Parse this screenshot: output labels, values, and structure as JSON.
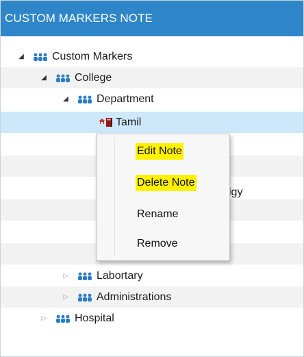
{
  "header": {
    "title": "CUSTOM MARKERS NOTE"
  },
  "tree": {
    "root": {
      "label": "Custom Markers"
    },
    "college": {
      "label": "College"
    },
    "department": {
      "label": "Department"
    },
    "tamil": {
      "label": "Tamil"
    },
    "hidden_item_suffix": "lgy",
    "labortary": {
      "label": "Labortary"
    },
    "administrations": {
      "label": "Administrations"
    },
    "hospital": {
      "label": "Hospital"
    }
  },
  "context_menu": {
    "items": [
      {
        "label": "Edit Note",
        "highlighted": true
      },
      {
        "label": "Delete Note",
        "highlighted": true
      },
      {
        "label": "Rename",
        "highlighted": false
      },
      {
        "label": "Remove",
        "highlighted": false
      }
    ]
  },
  "colors": {
    "header": "#2e86c8",
    "selected_row": "#cde8fa",
    "alt_row": "#f2f2f2",
    "highlight": "#fff200",
    "group_icon": "#2b7cc4"
  },
  "icons": {
    "group": "people-group-icon",
    "note": "note-marker-icon"
  }
}
